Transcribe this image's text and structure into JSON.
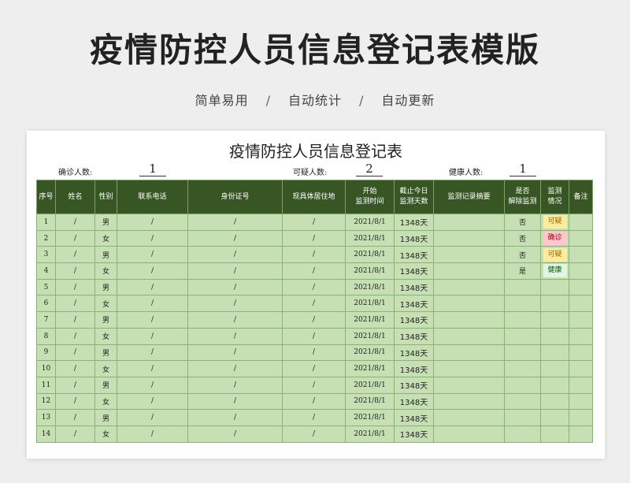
{
  "page": {
    "title": "疫情防控人员信息登记表模版",
    "features": [
      "简单易用",
      "自动统计",
      "自动更新"
    ],
    "separator": "/"
  },
  "sheet": {
    "title": "疫情防控人员信息登记表",
    "summary": {
      "confirmed_label": "确诊人数:",
      "confirmed_value": "1",
      "suspected_label": "可疑人数:",
      "suspected_value": "2",
      "healthy_label": "健康人数:",
      "healthy_value": "1"
    },
    "headers": [
      "序号",
      "姓名",
      "性别",
      "联系电话",
      "身份证号",
      "现具体居住地",
      "开始\n监测时间",
      "截止今日\n监测天数",
      "监测记录摘要",
      "是否\n解除监测",
      "监测\n情况",
      "备注"
    ],
    "rows": [
      {
        "no": "1",
        "name": "/",
        "gender": "男",
        "phone": "/",
        "id": "/",
        "addr": "/",
        "start": "2021/8/1",
        "days": "1348天",
        "summary": "",
        "released": "否",
        "status": "可疑",
        "note": ""
      },
      {
        "no": "2",
        "name": "/",
        "gender": "女",
        "phone": "/",
        "id": "/",
        "addr": "/",
        "start": "2021/8/1",
        "days": "1348天",
        "summary": "",
        "released": "否",
        "status": "确诊",
        "note": ""
      },
      {
        "no": "3",
        "name": "/",
        "gender": "男",
        "phone": "/",
        "id": "/",
        "addr": "/",
        "start": "2021/8/1",
        "days": "1348天",
        "summary": "",
        "released": "否",
        "status": "可疑",
        "note": ""
      },
      {
        "no": "4",
        "name": "/",
        "gender": "女",
        "phone": "/",
        "id": "/",
        "addr": "/",
        "start": "2021/8/1",
        "days": "1348天",
        "summary": "",
        "released": "是",
        "status": "健康",
        "note": ""
      },
      {
        "no": "5",
        "name": "/",
        "gender": "男",
        "phone": "/",
        "id": "/",
        "addr": "/",
        "start": "2021/8/1",
        "days": "1348天",
        "summary": "",
        "released": "",
        "status": "",
        "note": ""
      },
      {
        "no": "6",
        "name": "/",
        "gender": "女",
        "phone": "/",
        "id": "/",
        "addr": "/",
        "start": "2021/8/1",
        "days": "1348天",
        "summary": "",
        "released": "",
        "status": "",
        "note": ""
      },
      {
        "no": "7",
        "name": "/",
        "gender": "男",
        "phone": "/",
        "id": "/",
        "addr": "/",
        "start": "2021/8/1",
        "days": "1348天",
        "summary": "",
        "released": "",
        "status": "",
        "note": ""
      },
      {
        "no": "8",
        "name": "/",
        "gender": "女",
        "phone": "/",
        "id": "/",
        "addr": "/",
        "start": "2021/8/1",
        "days": "1348天",
        "summary": "",
        "released": "",
        "status": "",
        "note": ""
      },
      {
        "no": "9",
        "name": "/",
        "gender": "男",
        "phone": "/",
        "id": "/",
        "addr": "/",
        "start": "2021/8/1",
        "days": "1348天",
        "summary": "",
        "released": "",
        "status": "",
        "note": ""
      },
      {
        "no": "10",
        "name": "/",
        "gender": "女",
        "phone": "/",
        "id": "/",
        "addr": "/",
        "start": "2021/8/1",
        "days": "1348天",
        "summary": "",
        "released": "",
        "status": "",
        "note": ""
      },
      {
        "no": "11",
        "name": "/",
        "gender": "男",
        "phone": "/",
        "id": "/",
        "addr": "/",
        "start": "2021/8/1",
        "days": "1348天",
        "summary": "",
        "released": "",
        "status": "",
        "note": ""
      },
      {
        "no": "12",
        "name": "/",
        "gender": "女",
        "phone": "/",
        "id": "/",
        "addr": "/",
        "start": "2021/8/1",
        "days": "1348天",
        "summary": "",
        "released": "",
        "status": "",
        "note": ""
      },
      {
        "no": "13",
        "name": "/",
        "gender": "男",
        "phone": "/",
        "id": "/",
        "addr": "/",
        "start": "2021/8/1",
        "days": "1348天",
        "summary": "",
        "released": "",
        "status": "",
        "note": ""
      },
      {
        "no": "14",
        "name": "/",
        "gender": "女",
        "phone": "/",
        "id": "/",
        "addr": "/",
        "start": "2021/8/1",
        "days": "1348天",
        "summary": "",
        "released": "",
        "status": "",
        "note": ""
      }
    ],
    "status_colors": {
      "可疑": "#ffeb9c",
      "确诊": "#ffc7ce",
      "健康": "#e2f5e4"
    }
  }
}
